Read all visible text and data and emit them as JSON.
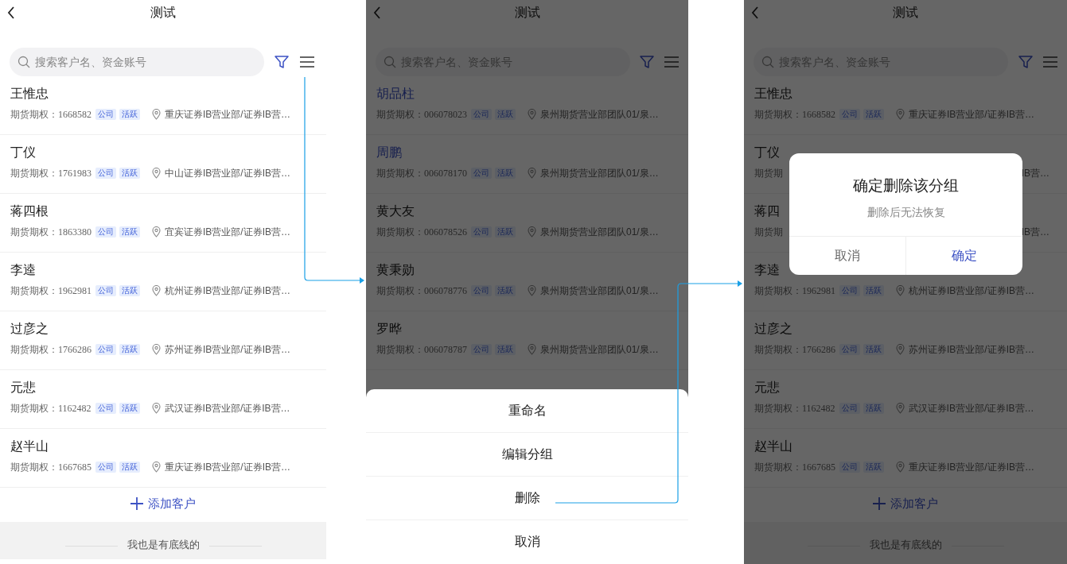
{
  "screens": [
    {
      "kind": "list",
      "title": "测试",
      "search_placeholder": "搜索客户名、资金账号",
      "rows": [
        {
          "kind": "full",
          "name": "王惟忠",
          "label": "期货期权：",
          "account": "1668582",
          "tags": [
            "公司",
            "活跃"
          ],
          "branch": "重庆证券IB营业部/证券IB营…"
        },
        {
          "kind": "full",
          "name": "丁仪",
          "label": "期货期权：",
          "account": "1761983",
          "tags": [
            "公司",
            "活跃"
          ],
          "branch": "中山证券IB营业部/证券IB营…"
        },
        {
          "kind": "full",
          "name": "蒋四根",
          "label": "期货期权：",
          "account": "1863380",
          "tags": [
            "公司",
            "活跃"
          ],
          "branch": "宜宾证券IB营业部/证券IB营…"
        },
        {
          "kind": "full",
          "name": "李逵",
          "label": "期货期权：",
          "account": "1962981",
          "tags": [
            "公司",
            "活跃"
          ],
          "branch": "杭州证券IB营业部/证券IB营…"
        },
        {
          "kind": "full",
          "name": "过彦之",
          "label": "期货期权：",
          "account": "1766286",
          "tags": [
            "公司",
            "活跃"
          ],
          "branch": "苏州证券IB营业部/证券IB营…"
        },
        {
          "kind": "full",
          "name": "元悲",
          "label": "期货期权：",
          "account": "1162482",
          "tags": [
            "公司",
            "活跃"
          ],
          "branch": "武汉证券IB营业部/证券IB营…"
        },
        {
          "kind": "full",
          "name": "赵半山",
          "label": "期货期权：",
          "account": "1667685",
          "tags": [
            "公司",
            "活跃"
          ],
          "branch": "重庆证券IB营业部/证券IB营…"
        }
      ],
      "add_label": "添加客户",
      "footer": "我也是有底线的"
    },
    {
      "kind": "sheet",
      "title": "测试",
      "search_placeholder": "搜索客户名、资金账号",
      "rows": [
        {
          "kind": "full",
          "name": "胡品柱",
          "highlighted": true,
          "label": "期货期权：",
          "account": "006078023",
          "tags": [
            "公司",
            "活跃"
          ],
          "branch": "泉州期货营业部团队01/泉…"
        },
        {
          "kind": "full",
          "name": "周鹏",
          "highlighted": true,
          "label": "期货期权：",
          "account": "006078170",
          "tags": [
            "公司",
            "活跃"
          ],
          "branch": "泉州期货营业部团队01/泉…"
        },
        {
          "kind": "full",
          "name": "黄大友",
          "highlighted": false,
          "label": "期货期权：",
          "account": "006078526",
          "tags": [
            "公司",
            "活跃"
          ],
          "branch": "泉州期货营业部团队01/泉…"
        },
        {
          "kind": "full",
          "name": "黄秉勋",
          "highlighted": false,
          "label": "期货期权：",
          "account": "006078776",
          "tags": [
            "公司",
            "活跃"
          ],
          "branch": "泉州期货营业部团队01/泉…"
        },
        {
          "kind": "full",
          "name": "罗晔",
          "highlighted": false,
          "label": "期货期权：",
          "account": "006078787",
          "tags": [
            "公司",
            "活跃"
          ],
          "branch": "泉州期货营业部团队01/泉…"
        }
      ],
      "sheet": {
        "items": [
          "重命名",
          "编辑分组",
          "删除"
        ],
        "cancel": "取消"
      }
    },
    {
      "kind": "dialog",
      "title": "测试",
      "search_placeholder": "搜索客户名、资金账号",
      "rows": [
        {
          "kind": "full",
          "name": "王惟忠",
          "label": "期货期权：",
          "account": "1668582",
          "tags": [
            "公司",
            "活跃"
          ],
          "branch": "重庆证券IB营业部/证券IB营…"
        },
        {
          "kind": "partial",
          "name": "丁仪",
          "left": "期货期",
          "right": "IB营…"
        },
        {
          "kind": "partial",
          "name": "蒋四",
          "left": "期货期",
          "right": "IB营…"
        },
        {
          "kind": "full",
          "name": "李逵",
          "label": "期货期权：",
          "account": "1962981",
          "tags": [
            "公司",
            "活跃"
          ],
          "branch": "杭州证券IB营业部/证券IB营…"
        },
        {
          "kind": "full",
          "name": "过彦之",
          "label": "期货期权：",
          "account": "1766286",
          "tags": [
            "公司",
            "活跃"
          ],
          "branch": "苏州证券IB营业部/证券IB营…"
        },
        {
          "kind": "full",
          "name": "元悲",
          "label": "期货期权：",
          "account": "1162482",
          "tags": [
            "公司",
            "活跃"
          ],
          "branch": "武汉证券IB营业部/证券IB营…"
        },
        {
          "kind": "full",
          "name": "赵半山",
          "label": "期货期权：",
          "account": "1667685",
          "tags": [
            "公司",
            "活跃"
          ],
          "branch": "重庆证券IB营业部/证券IB营…"
        }
      ],
      "add_label": "添加客户",
      "footer": "我也是有底线的",
      "dialog": {
        "title": "确定删除该分组",
        "message": "删除后无法恢复",
        "buttons": [
          {
            "label": "取消",
            "primary": false
          },
          {
            "label": "确定",
            "primary": true
          }
        ]
      }
    }
  ]
}
